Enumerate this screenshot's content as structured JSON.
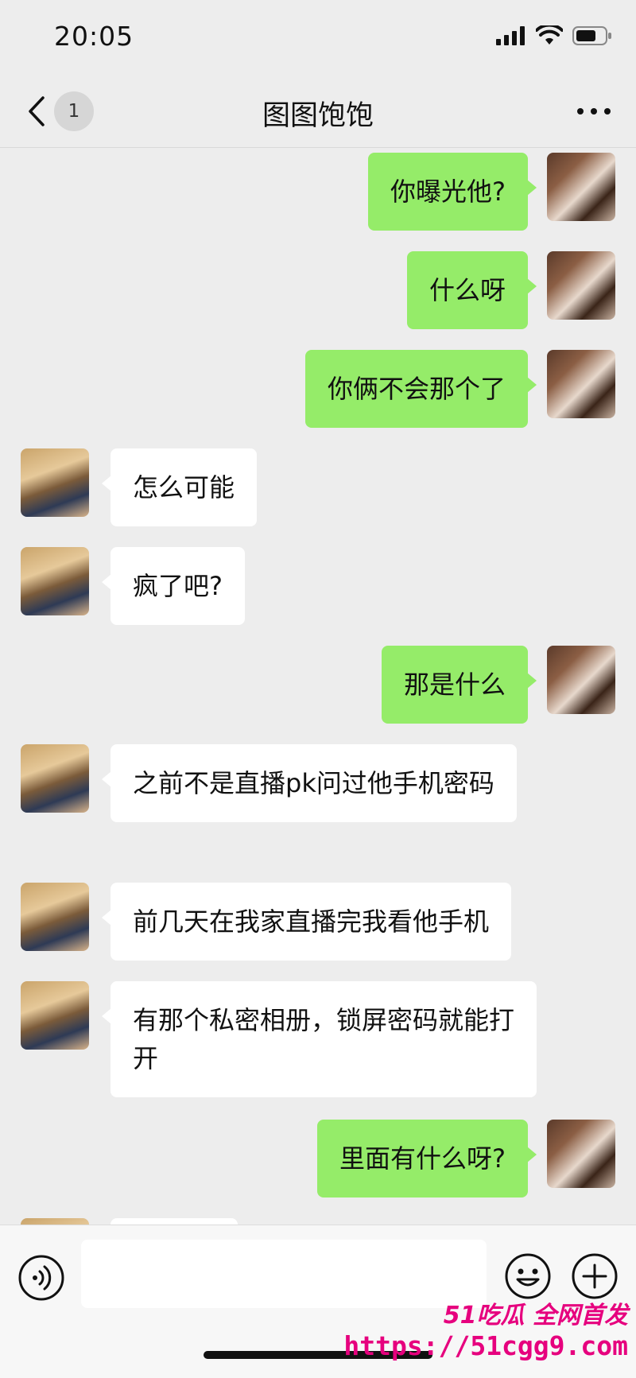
{
  "status_bar": {
    "time": "20:05",
    "icons": [
      "signal-icon",
      "wifi-icon",
      "battery-icon"
    ]
  },
  "nav": {
    "unread_count": "1",
    "title": "图图饱饱"
  },
  "messages": [
    {
      "from": "me",
      "text": "你曝光他?"
    },
    {
      "from": "me",
      "text": "什么呀"
    },
    {
      "from": "me",
      "text": "你俩不会那个了"
    },
    {
      "from": "other",
      "text": "怎么可能"
    },
    {
      "from": "other",
      "text": "疯了吧?"
    },
    {
      "from": "me",
      "text": "那是什么"
    },
    {
      "from": "other",
      "text": "之前不是直播pk问过他手机密码"
    },
    {
      "from": "other",
      "text": "前几天在我家直播完我看他手机"
    },
    {
      "from": "other",
      "text": "有那个私密相册，锁屏密码就能打开"
    },
    {
      "from": "me",
      "text": "里面有什么呀?"
    }
  ],
  "input_bar": {
    "icons": [
      "voice-icon",
      "emoji-icon",
      "plus-icon"
    ]
  },
  "watermark": {
    "brand": "51吃瓜 全网首发",
    "url": "https://51cgg9.com"
  },
  "colors": {
    "my_bubble": "#95ec69",
    "other_bubble": "#ffffff",
    "background": "#ededed",
    "watermark": "#e6007e"
  }
}
